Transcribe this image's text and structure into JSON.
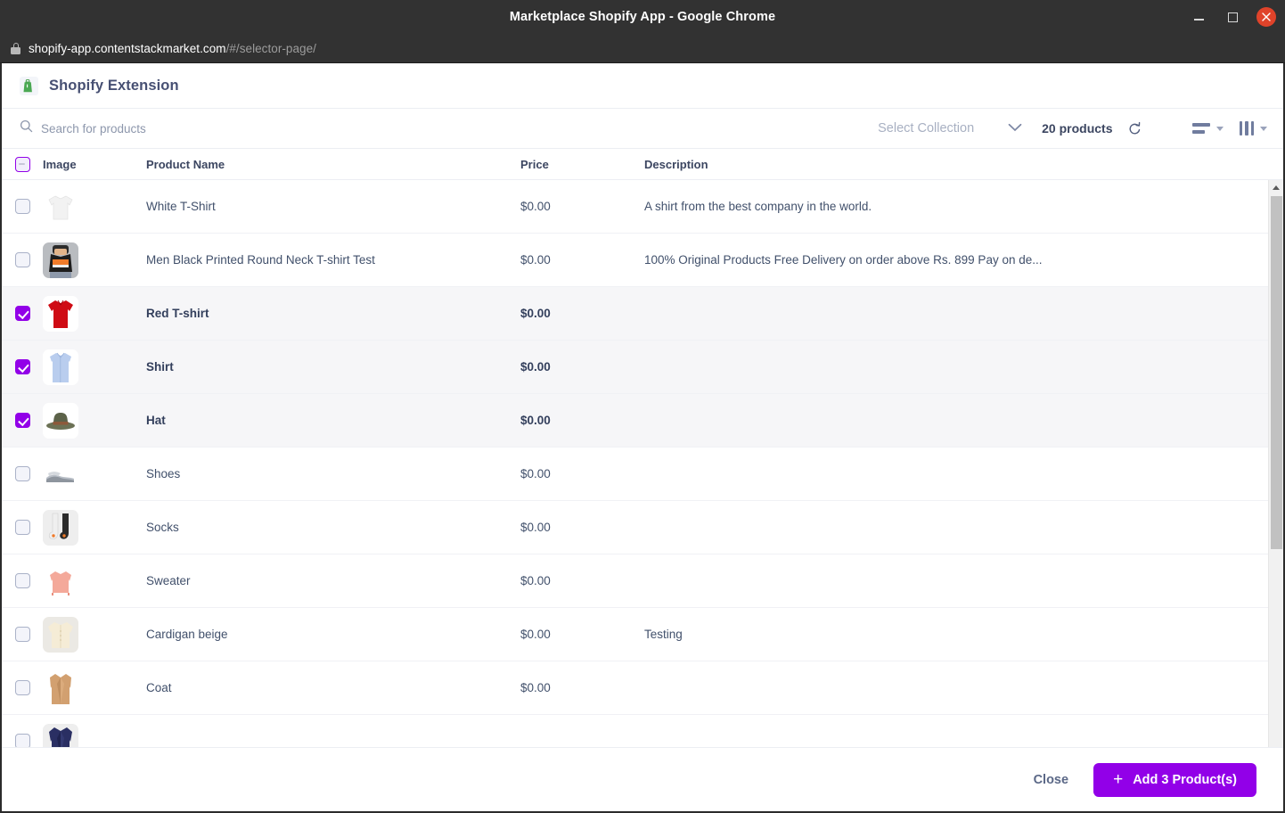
{
  "window": {
    "title": "Marketplace Shopify App - Google Chrome",
    "controls": {
      "minimize": "–",
      "maximize": "□",
      "close": "✕"
    }
  },
  "browser": {
    "url_domain": "shopify-app.contentstackmarket.com",
    "url_path": "/#/selector-page/"
  },
  "app": {
    "title": "Shopify Extension",
    "logo_icon": "shopify-bag-icon"
  },
  "toolbar": {
    "search_placeholder": "Search for products",
    "search_value": "",
    "search_icon": "search-icon",
    "collection_label": "Select Collection",
    "collection_chevron_icon": "chevron-down-icon",
    "product_count": "20 products",
    "refresh_icon": "refresh-icon",
    "rows_view_icon": "rows-density-icon",
    "columns_view_icon": "columns-selector-icon"
  },
  "table": {
    "headers": {
      "image": "Image",
      "product_name": "Product Name",
      "price": "Price",
      "description": "Description"
    },
    "select_all_state": "indeterminate",
    "rows": [
      {
        "name": "White T-Shirt",
        "price": "$0.00",
        "description": "A shirt from the best company in the world.",
        "selected": false,
        "thumb": "white-tshirt"
      },
      {
        "name": "Men Black Printed Round Neck T-shirt Test",
        "price": "$0.00",
        "description": "100% Original Products Free Delivery on order above Rs. 899 Pay on de...",
        "selected": false,
        "thumb": "black-tshirt-photo"
      },
      {
        "name": "Red T-shirt",
        "price": "$0.00",
        "description": "",
        "selected": true,
        "thumb": "red-tshirt"
      },
      {
        "name": "Shirt",
        "price": "$0.00",
        "description": "",
        "selected": true,
        "thumb": "blue-shirt"
      },
      {
        "name": "Hat",
        "price": "$0.00",
        "description": "",
        "selected": true,
        "thumb": "hat"
      },
      {
        "name": "Shoes",
        "price": "$0.00",
        "description": "",
        "selected": false,
        "thumb": "shoes"
      },
      {
        "name": "Socks",
        "price": "$0.00",
        "description": "",
        "selected": false,
        "thumb": "socks"
      },
      {
        "name": "Sweater",
        "price": "$0.00",
        "description": "",
        "selected": false,
        "thumb": "sweater"
      },
      {
        "name": "Cardigan beige",
        "price": "$0.00",
        "description": "Testing",
        "selected": false,
        "thumb": "cardigan"
      },
      {
        "name": "Coat",
        "price": "$0.00",
        "description": "",
        "selected": false,
        "thumb": "coat"
      },
      {
        "name": "",
        "price": "",
        "description": "",
        "selected": false,
        "thumb": "navy-jacket"
      }
    ]
  },
  "footer": {
    "close_label": "Close",
    "add_label": "Add 3 Product(s)",
    "add_plus_icon": "plus-icon"
  },
  "colors": {
    "accent_purple": "#9200e8",
    "title_slate": "#475073",
    "text_body": "#41506b",
    "chrome_dark": "#323232",
    "close_red": "#e0432a"
  }
}
